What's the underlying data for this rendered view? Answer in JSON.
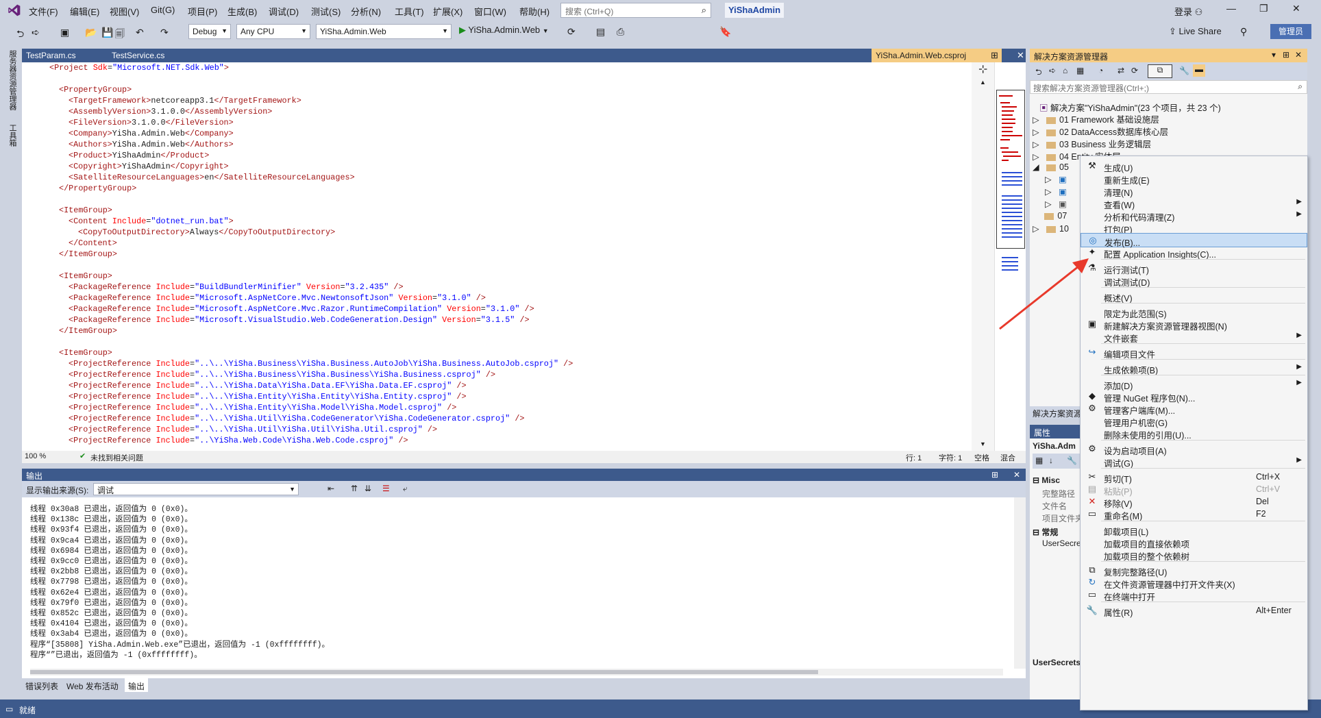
{
  "menubar": {
    "items": [
      "文件(F)",
      "编辑(E)",
      "视图(V)",
      "Git(G)",
      "项目(P)",
      "生成(B)",
      "调试(D)",
      "测试(S)",
      "分析(N)",
      "工具(T)",
      "扩展(X)",
      "窗口(W)",
      "帮助(H)"
    ],
    "search_placeholder": "搜索 (Ctrl+Q)",
    "app_title": "YiShaAdmin",
    "login": "登录"
  },
  "toolbar": {
    "config": "Debug",
    "platform": "Any CPU",
    "startup_project": "YiSha.Admin.Web",
    "run_label": "YiSha.Admin.Web",
    "live_share": "Live Share",
    "admin": "管理员"
  },
  "left_rail": {
    "items": [
      "服务器资源管理器",
      "工具箱"
    ]
  },
  "doc_tabs": {
    "tabs": [
      "TestParam.cs",
      "TestService.cs"
    ],
    "active": "YiSha.Admin.Web.csproj"
  },
  "editor": {
    "lines": [
      {
        "indent": 0,
        "parts": [
          [
            "t",
            "<Project "
          ],
          [
            "a",
            "Sdk"
          ],
          [
            "x",
            "="
          ],
          [
            "q",
            "\"Microsoft.NET.Sdk.Web\""
          ],
          [
            "t",
            ">"
          ]
        ]
      },
      {
        "indent": 0,
        "parts": []
      },
      {
        "indent": 1,
        "parts": [
          [
            "t",
            "<PropertyGroup>"
          ]
        ]
      },
      {
        "indent": 2,
        "parts": [
          [
            "t",
            "<TargetFramework>"
          ],
          [
            "x",
            "netcoreapp3.1"
          ],
          [
            "t",
            "</TargetFramework>"
          ]
        ]
      },
      {
        "indent": 2,
        "parts": [
          [
            "t",
            "<AssemblyVersion>"
          ],
          [
            "x",
            "3.1.0.0"
          ],
          [
            "t",
            "</AssemblyVersion>"
          ]
        ]
      },
      {
        "indent": 2,
        "parts": [
          [
            "t",
            "<FileVersion>"
          ],
          [
            "x",
            "3.1.0.0"
          ],
          [
            "t",
            "</FileVersion>"
          ]
        ]
      },
      {
        "indent": 2,
        "parts": [
          [
            "t",
            "<Company>"
          ],
          [
            "x",
            "YiSha.Admin.Web"
          ],
          [
            "t",
            "</Company>"
          ]
        ]
      },
      {
        "indent": 2,
        "parts": [
          [
            "t",
            "<Authors>"
          ],
          [
            "x",
            "YiSha.Admin.Web"
          ],
          [
            "t",
            "</Authors>"
          ]
        ]
      },
      {
        "indent": 2,
        "parts": [
          [
            "t",
            "<Product>"
          ],
          [
            "x",
            "YiShaAdmin"
          ],
          [
            "t",
            "</Product>"
          ]
        ]
      },
      {
        "indent": 2,
        "parts": [
          [
            "t",
            "<Copyright>"
          ],
          [
            "x",
            "YiShaAdmin"
          ],
          [
            "t",
            "</Copyright>"
          ]
        ]
      },
      {
        "indent": 2,
        "parts": [
          [
            "t",
            "<SatelliteResourceLanguages>"
          ],
          [
            "x",
            "en"
          ],
          [
            "t",
            "</SatelliteResourceLanguages>"
          ]
        ]
      },
      {
        "indent": 1,
        "parts": [
          [
            "t",
            "</PropertyGroup>"
          ]
        ]
      },
      {
        "indent": 0,
        "parts": []
      },
      {
        "indent": 1,
        "parts": [
          [
            "t",
            "<ItemGroup>"
          ]
        ]
      },
      {
        "indent": 2,
        "parts": [
          [
            "t",
            "<Content "
          ],
          [
            "a",
            "Include"
          ],
          [
            "x",
            "="
          ],
          [
            "q",
            "\"dotnet_run.bat\""
          ],
          [
            "t",
            ">"
          ]
        ]
      },
      {
        "indent": 3,
        "parts": [
          [
            "t",
            "<CopyToOutputDirectory>"
          ],
          [
            "x",
            "Always"
          ],
          [
            "t",
            "</CopyToOutputDirectory>"
          ]
        ]
      },
      {
        "indent": 2,
        "parts": [
          [
            "t",
            "</Content>"
          ]
        ]
      },
      {
        "indent": 1,
        "parts": [
          [
            "t",
            "</ItemGroup>"
          ]
        ]
      },
      {
        "indent": 0,
        "parts": []
      },
      {
        "indent": 1,
        "parts": [
          [
            "t",
            "<ItemGroup>"
          ]
        ]
      },
      {
        "indent": 2,
        "parts": [
          [
            "t",
            "<PackageReference "
          ],
          [
            "a",
            "Include"
          ],
          [
            "x",
            "="
          ],
          [
            "q",
            "\"BuildBundlerMinifier\""
          ],
          [
            "a",
            " Version"
          ],
          [
            "x",
            "="
          ],
          [
            "q",
            "\"3.2.435\""
          ],
          [
            "t",
            " />"
          ]
        ]
      },
      {
        "indent": 2,
        "parts": [
          [
            "t",
            "<PackageReference "
          ],
          [
            "a",
            "Include"
          ],
          [
            "x",
            "="
          ],
          [
            "q",
            "\"Microsoft.AspNetCore.Mvc.NewtonsoftJson\""
          ],
          [
            "a",
            " Version"
          ],
          [
            "x",
            "="
          ],
          [
            "q",
            "\"3.1.0\""
          ],
          [
            "t",
            " />"
          ]
        ]
      },
      {
        "indent": 2,
        "parts": [
          [
            "t",
            "<PackageReference "
          ],
          [
            "a",
            "Include"
          ],
          [
            "x",
            "="
          ],
          [
            "q",
            "\"Microsoft.AspNetCore.Mvc.Razor.RuntimeCompilation\""
          ],
          [
            "a",
            " Version"
          ],
          [
            "x",
            "="
          ],
          [
            "q",
            "\"3.1.0\""
          ],
          [
            "t",
            " />"
          ]
        ]
      },
      {
        "indent": 2,
        "parts": [
          [
            "t",
            "<PackageReference "
          ],
          [
            "a",
            "Include"
          ],
          [
            "x",
            "="
          ],
          [
            "q",
            "\"Microsoft.VisualStudio.Web.CodeGeneration.Design\""
          ],
          [
            "a",
            " Version"
          ],
          [
            "x",
            "="
          ],
          [
            "q",
            "\"3.1.5\""
          ],
          [
            "t",
            " />"
          ]
        ]
      },
      {
        "indent": 1,
        "parts": [
          [
            "t",
            "</ItemGroup>"
          ]
        ]
      },
      {
        "indent": 0,
        "parts": []
      },
      {
        "indent": 1,
        "parts": [
          [
            "t",
            "<ItemGroup>"
          ]
        ]
      },
      {
        "indent": 2,
        "parts": [
          [
            "t",
            "<ProjectReference "
          ],
          [
            "a",
            "Include"
          ],
          [
            "x",
            "="
          ],
          [
            "q",
            "\"..\\..\\YiSha.Business\\YiSha.Business.AutoJob\\YiSha.Business.AutoJob.csproj\""
          ],
          [
            "t",
            " />"
          ]
        ]
      },
      {
        "indent": 2,
        "parts": [
          [
            "t",
            "<ProjectReference "
          ],
          [
            "a",
            "Include"
          ],
          [
            "x",
            "="
          ],
          [
            "q",
            "\"..\\..\\YiSha.Business\\YiSha.Business\\YiSha.Business.csproj\""
          ],
          [
            "t",
            " />"
          ]
        ]
      },
      {
        "indent": 2,
        "parts": [
          [
            "t",
            "<ProjectReference "
          ],
          [
            "a",
            "Include"
          ],
          [
            "x",
            "="
          ],
          [
            "q",
            "\"..\\..\\YiSha.Data\\YiSha.Data.EF\\YiSha.Data.EF.csproj\""
          ],
          [
            "t",
            " />"
          ]
        ]
      },
      {
        "indent": 2,
        "parts": [
          [
            "t",
            "<ProjectReference "
          ],
          [
            "a",
            "Include"
          ],
          [
            "x",
            "="
          ],
          [
            "q",
            "\"..\\..\\YiSha.Entity\\YiSha.Entity\\YiSha.Entity.csproj\""
          ],
          [
            "t",
            " />"
          ]
        ]
      },
      {
        "indent": 2,
        "parts": [
          [
            "t",
            "<ProjectReference "
          ],
          [
            "a",
            "Include"
          ],
          [
            "x",
            "="
          ],
          [
            "q",
            "\"..\\..\\YiSha.Entity\\YiSha.Model\\YiSha.Model.csproj\""
          ],
          [
            "t",
            " />"
          ]
        ]
      },
      {
        "indent": 2,
        "parts": [
          [
            "t",
            "<ProjectReference "
          ],
          [
            "a",
            "Include"
          ],
          [
            "x",
            "="
          ],
          [
            "q",
            "\"..\\..\\YiSha.Util\\YiSha.CodeGenerator\\YiSha.CodeGenerator.csproj\""
          ],
          [
            "t",
            " />"
          ]
        ]
      },
      {
        "indent": 2,
        "parts": [
          [
            "t",
            "<ProjectReference "
          ],
          [
            "a",
            "Include"
          ],
          [
            "x",
            "="
          ],
          [
            "q",
            "\"..\\..\\YiSha.Util\\YiSha.Util\\YiSha.Util.csproj\""
          ],
          [
            "t",
            " />"
          ]
        ]
      },
      {
        "indent": 2,
        "parts": [
          [
            "t",
            "<ProjectReference "
          ],
          [
            "a",
            "Include"
          ],
          [
            "x",
            "="
          ],
          [
            "q",
            "\"..\\YiSha.Web.Code\\YiSha.Web.Code.csproj\""
          ],
          [
            "t",
            " />"
          ]
        ]
      }
    ],
    "zoom": "100 %",
    "status": "未找到相关问题",
    "row": "行: 1",
    "col": "字符: 1",
    "ws": "空格",
    "eol": "混合"
  },
  "output": {
    "title": "输出",
    "source_label": "显示输出来源(S):",
    "source_value": "调试",
    "lines": [
      "线程 0x30a8 已退出，返回值为 0 (0x0)。",
      "线程 0x138c 已退出，返回值为 0 (0x0)。",
      "线程 0x93f4 已退出，返回值为 0 (0x0)。",
      "线程 0x9ca4 已退出，返回值为 0 (0x0)。",
      "线程 0x6984 已退出，返回值为 0 (0x0)。",
      "线程 0x9cc0 已退出，返回值为 0 (0x0)。",
      "线程 0x2bb8 已退出，返回值为 0 (0x0)。",
      "线程 0x7798 已退出，返回值为 0 (0x0)。",
      "线程 0x62e4 已退出，返回值为 0 (0x0)。",
      "线程 0x79f0 已退出，返回值为 0 (0x0)。",
      "线程 0x852c 已退出，返回值为 0 (0x0)。",
      "线程 0x4104 已退出，返回值为 0 (0x0)。",
      "线程 0x3ab4 已退出，返回值为 0 (0x0)。",
      "程序“[35808] YiSha.Admin.Web.exe”已退出，返回值为 -1 (0xffffffff)。",
      "程序“”已退出，返回值为 -1 (0xffffffff)。"
    ]
  },
  "bottom_tabs": [
    "错误列表",
    "Web 发布活动",
    "输出"
  ],
  "status_bar": {
    "text": "就绪"
  },
  "solution": {
    "title": "解决方案资源管理器",
    "search_placeholder": "搜索解决方案资源管理器(Ctrl+;)",
    "root": "解决方案\"YiShaAdmin\"(23 个项目，共 23 个)",
    "folders": [
      "01 Framework 基础设施层",
      "02 DataAccess数据库核心层",
      "03 Business 业务逻辑层",
      "04 Entity 实体层",
      "05",
      "07",
      "10"
    ],
    "footer": "解决方案资源"
  },
  "properties": {
    "title": "属性",
    "object": "YiSha.Adm",
    "misc": "Misc",
    "rows": [
      "完整路径",
      "文件名",
      "项目文件夹"
    ],
    "common": "常规",
    "common_row": "UserSecre",
    "desc": "UserSecrets"
  },
  "context_menu": {
    "items": [
      {
        "label": "生成(U)",
        "icon": "build-icon",
        "glyph": "⚒"
      },
      {
        "label": "重新生成(E)"
      },
      {
        "label": "清理(N)"
      },
      {
        "label": "查看(W)",
        "sub": true
      },
      {
        "label": "分析和代码清理(Z)",
        "sub": true
      },
      {
        "label": "打包(P)"
      },
      {
        "label": "发布(B)...",
        "icon": "publish-icon",
        "glyph": "◎",
        "highlight": true
      },
      {
        "label": "配置 Application Insights(C)...",
        "icon": "insights-icon",
        "glyph": "✦"
      },
      {
        "sep": true
      },
      {
        "label": "运行测试(T)",
        "icon": "test-icon",
        "glyph": "⚗"
      },
      {
        "label": "调试测试(D)"
      },
      {
        "sep": true
      },
      {
        "label": "概述(V)"
      },
      {
        "sep": true
      },
      {
        "label": "限定为此范围(S)"
      },
      {
        "label": "新建解决方案资源管理器视图(N)",
        "icon": "new-view-icon",
        "glyph": "▣"
      },
      {
        "label": "文件嵌套",
        "sub": true
      },
      {
        "sep": true
      },
      {
        "label": "编辑项目文件",
        "icon": "edit-project-icon",
        "glyph": "↪"
      },
      {
        "sep": true
      },
      {
        "label": "生成依赖项(B)",
        "sub": true
      },
      {
        "sep": true
      },
      {
        "label": "添加(D)",
        "sub": true
      },
      {
        "label": "管理 NuGet 程序包(N)...",
        "icon": "nuget-icon",
        "glyph": "◆"
      },
      {
        "label": "管理客户端库(M)...",
        "icon": "client-lib-icon",
        "glyph": "⚙"
      },
      {
        "label": "管理用户机密(G)"
      },
      {
        "label": "删除未使用的引用(U)..."
      },
      {
        "sep": true
      },
      {
        "label": "设为启动项目(A)",
        "icon": "startup-icon",
        "glyph": "⚙"
      },
      {
        "label": "调试(G)",
        "sub": true
      },
      {
        "sep": true
      },
      {
        "label": "剪切(T)",
        "icon": "cut-icon",
        "glyph": "✂",
        "shortcut": "Ctrl+X"
      },
      {
        "label": "粘贴(P)",
        "icon": "paste-icon",
        "glyph": "▤",
        "shortcut": "Ctrl+V",
        "disabled": true
      },
      {
        "label": "移除(V)",
        "icon": "remove-icon",
        "glyph": "✕",
        "shortcut": "Del",
        "red": true
      },
      {
        "label": "重命名(M)",
        "icon": "rename-icon",
        "glyph": "▭",
        "shortcut": "F2"
      },
      {
        "sep": true
      },
      {
        "label": "卸载项目(L)"
      },
      {
        "label": "加载项目的直接依赖项"
      },
      {
        "label": "加载项目的整个依赖树"
      },
      {
        "sep": true
      },
      {
        "label": "复制完整路径(U)",
        "icon": "copy-path-icon",
        "glyph": "⧉"
      },
      {
        "label": "在文件资源管理器中打开文件夹(X)",
        "icon": "open-folder-icon",
        "glyph": "↻"
      },
      {
        "label": "在终端中打开",
        "icon": "terminal-icon",
        "glyph": "▭"
      },
      {
        "sep": true
      },
      {
        "label": "属性(R)",
        "icon": "properties-icon",
        "glyph": "🔧",
        "shortcut": "Alt+Enter"
      }
    ]
  },
  "colors": {
    "accent": "#3d5a8c",
    "highlight": "#c9def5",
    "arrow": "#e8392b"
  }
}
